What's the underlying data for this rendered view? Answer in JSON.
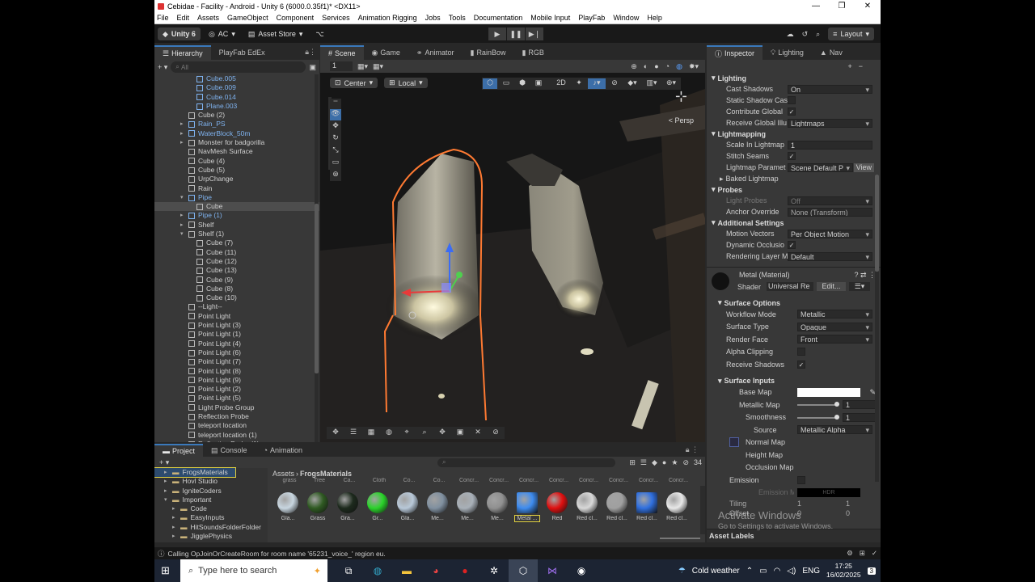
{
  "window": {
    "title": "Cebidae - Facility - Android - Unity 6 (6000.0.35f1)* <DX11>"
  },
  "menu": [
    "File",
    "Edit",
    "Assets",
    "GameObject",
    "Component",
    "Services",
    "Animation Rigging",
    "Jobs",
    "Tools",
    "Documentation",
    "Mobile Input",
    "PlayFab",
    "Window",
    "Help"
  ],
  "toolbar": {
    "unity": "Unity 6",
    "account": "AC",
    "asset_store": "Asset Store",
    "layout": "Layout"
  },
  "hierarchy": {
    "tabs": [
      "Hierarchy",
      "PlayFab EdEx"
    ],
    "search_placeholder": "All",
    "rows": [
      {
        "label": "Cube.005",
        "indent": 3,
        "blue": true,
        "arrow": ""
      },
      {
        "label": "Cube.009",
        "indent": 3,
        "blue": true,
        "arrow": ""
      },
      {
        "label": "Cube.014",
        "indent": 3,
        "blue": true,
        "arrow": ""
      },
      {
        "label": "Plane.003",
        "indent": 3,
        "blue": true,
        "arrow": ""
      },
      {
        "label": "Cube (2)",
        "indent": 2,
        "blue": false,
        "arrow": ""
      },
      {
        "label": "Rain_PS",
        "indent": 2,
        "blue": true,
        "arrow": "▸"
      },
      {
        "label": "WaterBlock_50m",
        "indent": 2,
        "blue": true,
        "arrow": "▸"
      },
      {
        "label": "Monster for badgorilla",
        "indent": 2,
        "blue": false,
        "arrow": "▸"
      },
      {
        "label": "NavMesh Surface",
        "indent": 2,
        "blue": false,
        "arrow": ""
      },
      {
        "label": "Cube (4)",
        "indent": 2,
        "blue": false,
        "arrow": ""
      },
      {
        "label": "Cube (5)",
        "indent": 2,
        "blue": false,
        "arrow": ""
      },
      {
        "label": "UrpChange",
        "indent": 2,
        "blue": false,
        "arrow": ""
      },
      {
        "label": "Rain",
        "indent": 2,
        "blue": false,
        "arrow": ""
      },
      {
        "label": "Pipe",
        "indent": 2,
        "blue": true,
        "arrow": "▾"
      },
      {
        "label": "Cube",
        "indent": 3,
        "blue": false,
        "arrow": "",
        "sel": true
      },
      {
        "label": "Pipe (1)",
        "indent": 2,
        "blue": true,
        "arrow": "▸"
      },
      {
        "label": "Shelf",
        "indent": 2,
        "blue": false,
        "arrow": "▸"
      },
      {
        "label": "Shelf (1)",
        "indent": 2,
        "blue": false,
        "arrow": "▾"
      },
      {
        "label": "Cube (7)",
        "indent": 3,
        "blue": false,
        "arrow": ""
      },
      {
        "label": "Cube (11)",
        "indent": 3,
        "blue": false,
        "arrow": ""
      },
      {
        "label": "Cube (12)",
        "indent": 3,
        "blue": false,
        "arrow": ""
      },
      {
        "label": "Cube (13)",
        "indent": 3,
        "blue": false,
        "arrow": ""
      },
      {
        "label": "Cube (9)",
        "indent": 3,
        "blue": false,
        "arrow": ""
      },
      {
        "label": "Cube (8)",
        "indent": 3,
        "blue": false,
        "arrow": ""
      },
      {
        "label": "Cube (10)",
        "indent": 3,
        "blue": false,
        "arrow": ""
      },
      {
        "label": "--Light--",
        "indent": 2,
        "blue": false,
        "arrow": ""
      },
      {
        "label": "Point Light",
        "indent": 2,
        "blue": false,
        "arrow": ""
      },
      {
        "label": "Point Light (3)",
        "indent": 2,
        "blue": false,
        "arrow": ""
      },
      {
        "label": "Point Light (1)",
        "indent": 2,
        "blue": false,
        "arrow": ""
      },
      {
        "label": "Point Light (4)",
        "indent": 2,
        "blue": false,
        "arrow": ""
      },
      {
        "label": "Point Light (6)",
        "indent": 2,
        "blue": false,
        "arrow": ""
      },
      {
        "label": "Point Light (7)",
        "indent": 2,
        "blue": false,
        "arrow": ""
      },
      {
        "label": "Point Light (8)",
        "indent": 2,
        "blue": false,
        "arrow": ""
      },
      {
        "label": "Point Light (9)",
        "indent": 2,
        "blue": false,
        "arrow": ""
      },
      {
        "label": "Point Light (2)",
        "indent": 2,
        "blue": false,
        "arrow": ""
      },
      {
        "label": "Point Light (5)",
        "indent": 2,
        "blue": false,
        "arrow": ""
      },
      {
        "label": "Light Probe Group",
        "indent": 2,
        "blue": false,
        "arrow": ""
      },
      {
        "label": "Reflection Probe",
        "indent": 2,
        "blue": false,
        "arrow": ""
      },
      {
        "label": "teleport location",
        "indent": 2,
        "blue": false,
        "arrow": ""
      },
      {
        "label": "teleport location (1)",
        "indent": 2,
        "blue": false,
        "arrow": ""
      },
      {
        "label": "Reflection Probe (1)",
        "indent": 2,
        "blue": false,
        "arrow": ""
      }
    ]
  },
  "scene": {
    "tabs": [
      "Scene",
      "Game",
      "Animator",
      "RainBow",
      "RGB"
    ],
    "pivot": "Center",
    "space": "Local",
    "mode2d": "2D",
    "persp": "< Persp",
    "counter": "1"
  },
  "inspector": {
    "tabs": [
      "Inspector",
      "Lighting",
      "Nav"
    ],
    "sections": {
      "lighting": "Lighting",
      "lightmapping": "Lightmapping",
      "probes": "Probes",
      "additional": "Additional Settings",
      "surface_options": "Surface Options",
      "surface_inputs": "Surface Inputs"
    },
    "cast_shadows": {
      "label": "Cast Shadows",
      "value": "On"
    },
    "static_shadow": {
      "label": "Static Shadow Cas"
    },
    "contribute_gi": {
      "label": "Contribute Global",
      "value": "✓"
    },
    "receive_gi": {
      "label": "Receive Global Illu",
      "value": "Lightmaps"
    },
    "scale_lightmap": {
      "label": "Scale In Lightmap",
      "value": "1"
    },
    "stitch_seams": {
      "label": "Stitch Seams",
      "value": "✓"
    },
    "lightmap_params": {
      "label": "Lightmap Paramet",
      "value": "Scene Default P",
      "btn": "View"
    },
    "baked_lightmap": "Baked Lightmap",
    "light_probes": {
      "label": "Light Probes",
      "value": "Off"
    },
    "anchor_override": {
      "label": "Anchor Override",
      "value": "None (Transform)"
    },
    "motion_vectors": {
      "label": "Motion Vectors",
      "value": "Per Object Motion"
    },
    "dynamic_occlusion": {
      "label": "Dynamic Occlusio",
      "value": "✓"
    },
    "rendering_layer": {
      "label": "Rendering Layer M",
      "value": "Default"
    },
    "material": {
      "name": "Metal (Material)",
      "shader_label": "Shader",
      "shader": "Universal Re",
      "edit": "Edit..."
    },
    "workflow": {
      "label": "Workflow Mode",
      "value": "Metallic"
    },
    "surface_type": {
      "label": "Surface Type",
      "value": "Opaque"
    },
    "render_face": {
      "label": "Render Face",
      "value": "Front"
    },
    "alpha_clip": {
      "label": "Alpha Clipping"
    },
    "receive_shadows": {
      "label": "Receive Shadows",
      "value": "✓"
    },
    "base_map": {
      "label": "Base Map"
    },
    "metallic_map": {
      "label": "Metallic Map",
      "value": "1"
    },
    "smoothness": {
      "label": "Smoothness",
      "value": "1"
    },
    "source": {
      "label": "Source",
      "value": "Metallic Alpha"
    },
    "normal_map": {
      "label": "Normal Map"
    },
    "height_map": {
      "label": "Height Map"
    },
    "occlusion_map": {
      "label": "Occlusion Map"
    },
    "emission": {
      "label": "Emission"
    },
    "emission_map": {
      "label": "Emission M",
      "value": "HDR"
    },
    "tiling": {
      "label": "Tiling",
      "x": "1",
      "y": "1"
    },
    "offset": {
      "label": "Offset",
      "x": "0",
      "y": "0"
    },
    "asset_labels": "Asset Labels",
    "watermark1": "Activate Windows",
    "watermark2": "Go to Settings to activate Windows."
  },
  "project": {
    "tabs": [
      "Project",
      "Console",
      "Animation"
    ],
    "breadcrumb_root": "Assets",
    "breadcrumb_folder": "FrogsMaterials",
    "count": "34",
    "folders": [
      {
        "label": "FrogsMaterials",
        "indent": 1,
        "sel": true
      },
      {
        "label": "Hovl Studio",
        "indent": 1
      },
      {
        "label": "IgniteCoders",
        "indent": 1
      },
      {
        "label": "Important",
        "indent": 1,
        "open": true
      },
      {
        "label": "Code",
        "indent": 2
      },
      {
        "label": "EasyInputs",
        "indent": 2
      },
      {
        "label": "HitSoundsFolderFolder",
        "indent": 2
      },
      {
        "label": "JigglePhysics",
        "indent": 2
      },
      {
        "label": "JigglePhysicsExample",
        "indent": 2
      }
    ],
    "top_labels": [
      "grass",
      "Tree",
      "Ca...",
      "Cloth",
      "Co...",
      "Co...",
      "Concr...",
      "Concr...",
      "Concr...",
      "Concr...",
      "Concr...",
      "Concr...",
      "Concr...",
      "Concr..."
    ],
    "assets": [
      {
        "label": "Gla...",
        "color": "#c8d6e0"
      },
      {
        "label": "Grass",
        "color": "#2f5a22"
      },
      {
        "label": "Gra...",
        "color": "#1d2a1d"
      },
      {
        "label": "Gr...",
        "color": "#2ad32a"
      },
      {
        "label": "Gla...",
        "color": "#b8c8d8"
      },
      {
        "label": "Me...",
        "color": "#8090a0"
      },
      {
        "label": "Me...",
        "color": "#a8b0b8"
      },
      {
        "label": "Me...",
        "color": "#909090"
      },
      {
        "label": "Metal ...",
        "color": "#3e8cf0"
      },
      {
        "label": "Red",
        "color": "#e01010"
      },
      {
        "label": "Red cl...",
        "color": "#d8d8d8"
      },
      {
        "label": "Red cl...",
        "color": "#a0a0a0"
      },
      {
        "label": "Red cl...",
        "color": "#3070e0"
      },
      {
        "label": "Red cl...",
        "color": "#e8e8e8"
      }
    ]
  },
  "status": {
    "message": "Calling OpJoinOrCreateRoom for room name '65231_voice_' region eu."
  },
  "taskbar": {
    "search": "Type here to search",
    "weather": "Cold weather",
    "lang": "ENG",
    "time": "17:25",
    "date": "16/02/2025",
    "notif": "3"
  }
}
